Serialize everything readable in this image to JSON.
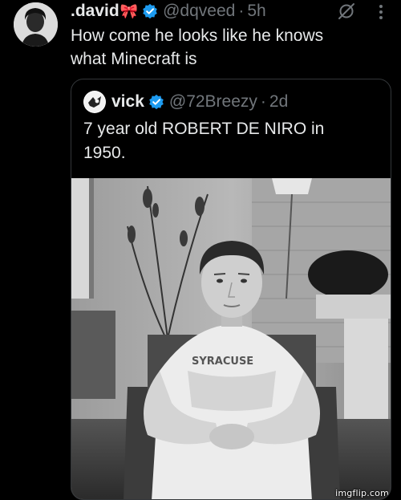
{
  "post": {
    "author": {
      "display_name": ".david",
      "emoji": "🎀",
      "handle": "@dqveed",
      "time": "5h",
      "verified_icon": "verified-badge-icon",
      "separator": "·"
    },
    "text_line1": "How come he looks like he knows",
    "text_line2": "what Minecraft is",
    "icons": [
      "grok-icon",
      "more-icon"
    ],
    "quote": {
      "display_name": "vick",
      "handle": "@72Breezy",
      "time": "2d",
      "separator": "·",
      "text_line1": "7 year old ROBERT DE NIRO in",
      "text_line2": "1950.",
      "photo_shirt_text": "SYRACUSE"
    }
  },
  "watermark": "imgflip.com",
  "colors": {
    "background": "#000000",
    "text": "#e7e9ea",
    "muted": "#71767b",
    "verified": "#1d9bf0",
    "border": "#333639"
  }
}
